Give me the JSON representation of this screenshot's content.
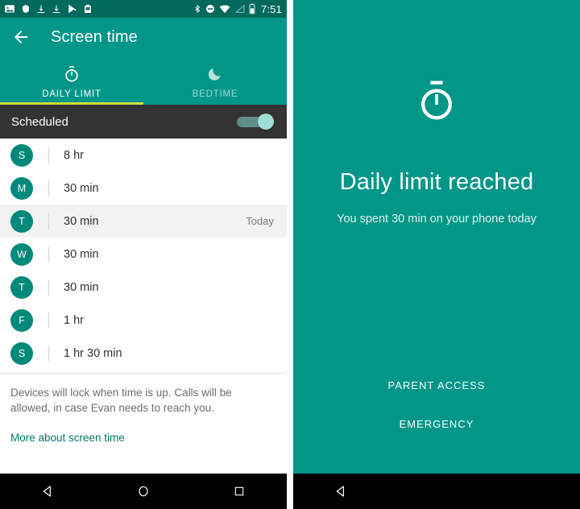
{
  "status_bar": {
    "time": "7:51",
    "left_icons": [
      "image-icon",
      "shield-icon",
      "download-icon",
      "download-icon",
      "play-store-icon",
      "clipboard-icon"
    ],
    "right_icons": [
      "bluetooth-icon",
      "do-not-disturb-icon",
      "wifi-icon",
      "signal-icon",
      "battery-icon"
    ]
  },
  "app_bar": {
    "title": "Screen time",
    "back_icon": "back-arrow-icon"
  },
  "tabs": [
    {
      "label": "DAILY LIMIT",
      "icon": "stopwatch-icon",
      "active": true
    },
    {
      "label": "BEDTIME",
      "icon": "moon-icon",
      "active": false
    }
  ],
  "scheduled": {
    "label": "Scheduled",
    "toggle_on": true
  },
  "schedule_rows": [
    {
      "day": "S",
      "time": "8 hr",
      "note": "",
      "today": false
    },
    {
      "day": "M",
      "time": "30 min",
      "note": "",
      "today": false
    },
    {
      "day": "T",
      "time": "30 min",
      "note": "Today",
      "today": true
    },
    {
      "day": "W",
      "time": "30 min",
      "note": "",
      "today": false
    },
    {
      "day": "T",
      "time": "30 min",
      "note": "",
      "today": false
    },
    {
      "day": "F",
      "time": "1 hr",
      "note": "",
      "today": false
    },
    {
      "day": "S",
      "time": "1 hr 30 min",
      "note": "",
      "today": false
    }
  ],
  "footer": {
    "description": "Devices will lock when time is up. Calls will be allowed, in case Evan needs to reach you.",
    "link": "More about screen time"
  },
  "lock_screen": {
    "icon": "stopwatch-icon",
    "title": "Daily limit reached",
    "subtitle": "You spent 30 min on your phone today",
    "actions": [
      {
        "label": "PARENT ACCESS"
      },
      {
        "label": "EMERGENCY"
      }
    ]
  },
  "nav_bar": {
    "back_icon": "nav-back-icon",
    "home_icon": "nav-home-icon",
    "recents_icon": "nav-recents-icon"
  },
  "colors": {
    "teal": "#009688",
    "teal_dark": "#00695c",
    "avatar": "#00897b",
    "indicator": "#cddc39",
    "dark_bar": "#333333",
    "link": "#00796b"
  }
}
